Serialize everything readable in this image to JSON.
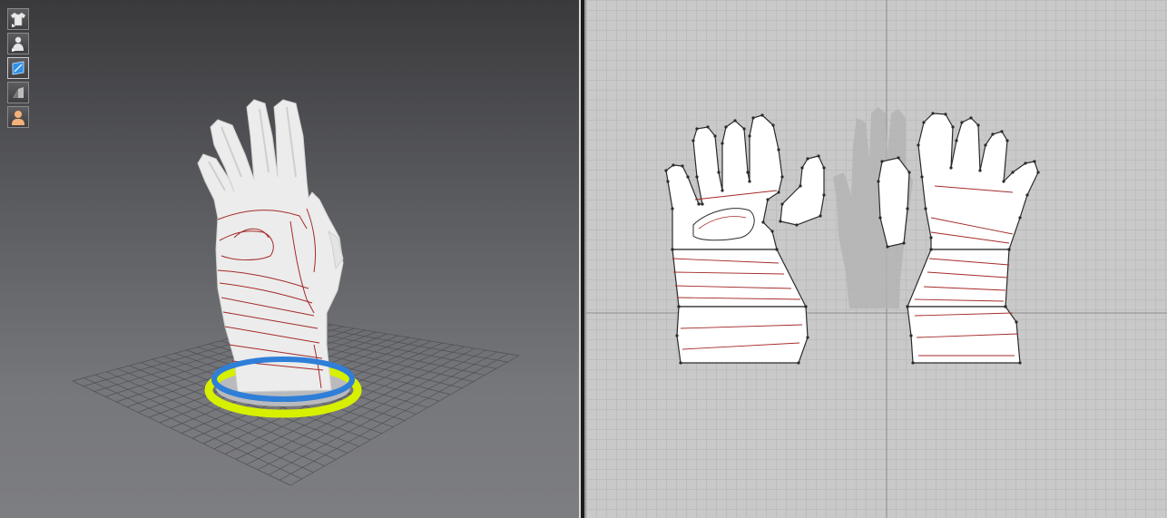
{
  "toolbar": {
    "buttons": [
      {
        "icon": "garment-icon"
      },
      {
        "icon": "avatar-icon"
      },
      {
        "icon": "texture-icon"
      },
      {
        "icon": "shaded-icon"
      },
      {
        "icon": "skin-icon"
      }
    ]
  },
  "colors": {
    "seam": "#a52a2a",
    "pattern_fill": "#ffffff",
    "pattern_outline": "#2b2b2b",
    "ring_blue": "#2f7fd8",
    "ring_yellow": "#d7f000",
    "grid_2d": "#bdbdbd",
    "axis_2d": "#8f8f8f"
  }
}
